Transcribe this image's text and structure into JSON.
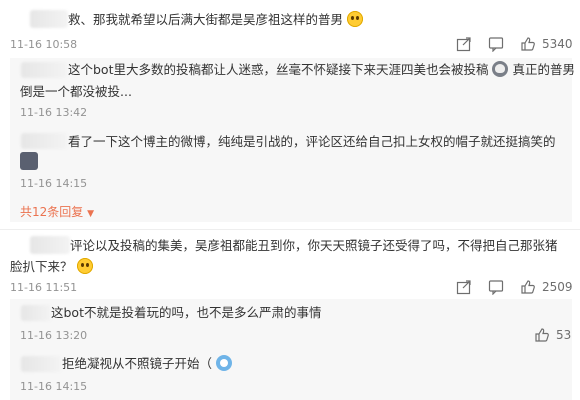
{
  "comments": [
    {
      "text_line1": "救、那我就希望以后满大街都是吴彦祖这样的普男",
      "time": "11-16 10:58",
      "likes": "5340",
      "replies": [
        {
          "text_line1": "这个bot里大多数的投稿都让人迷惑，丝毫不怀疑接下来天涯四美也会被投稿",
          "text_line1b": "真正的普男",
          "text_line2": "倒是一个都没被投...",
          "time": "11-16 13:42"
        },
        {
          "text_line1": "看了一下这个博主的微博，纯纯是引战的，评论区还给自己扣上女权的帽子就还挺搞笑的",
          "time": "11-16 14:15"
        }
      ],
      "more_replies": "共12条回复"
    },
    {
      "text_line1": "评论以及投稿的集美，吴彦祖都能丑到你，你天天照镜子还受得了吗，不得把自己那张猪",
      "text_line2": "脸扒下来？",
      "time": "11-16 11:51",
      "likes": "2509",
      "replies": [
        {
          "text_line1": "这bot不就是投着玩的吗，也不是多么严肃的事情",
          "time": "11-16 13:20",
          "likes": "53"
        },
        {
          "text_line1": "拒绝凝视从不照镜子开始（",
          "time": "11-16 14:15"
        }
      ]
    }
  ],
  "icons": {
    "share": "share-icon",
    "comment": "comment-icon",
    "like": "thumbs-up-icon",
    "arrow": "caret-down-icon"
  }
}
